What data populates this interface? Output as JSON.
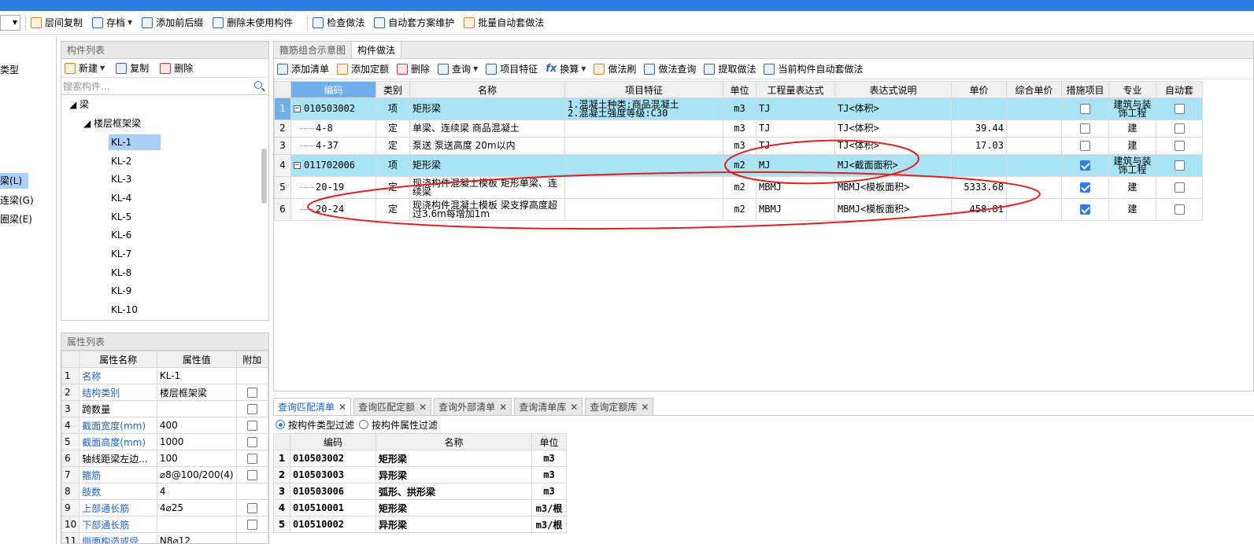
{
  "toolbar": {
    "items": [
      "层间复制",
      "存档",
      "添加前后缀",
      "删除未使用构件",
      "检查做法",
      "自动套方案维护",
      "批量自动套做法"
    ]
  },
  "left_edge": {
    "items": [
      "类型",
      "梁(L)",
      "连梁(G)",
      "圈梁(E)"
    ]
  },
  "component_list": {
    "title": "构件列表",
    "new_label": "新建",
    "copy_label": "复制",
    "delete_label": "删除",
    "search_placeholder": "搜索构件...",
    "root": "梁",
    "group": "楼层框架梁",
    "items": [
      "KL-1",
      "KL-2",
      "KL-3",
      "KL-4",
      "KL-5",
      "KL-6",
      "KL-7",
      "KL-8",
      "KL-9",
      "KL-10"
    ]
  },
  "property_list": {
    "title": "属性列表",
    "headers": [
      "属性名称",
      "属性值",
      "附加"
    ],
    "rows": [
      {
        "n": "1",
        "name": "名称",
        "value": "KL-1",
        "blue": true,
        "chk": false
      },
      {
        "n": "2",
        "name": "结构类别",
        "value": "楼层框架梁",
        "blue": true,
        "chk": true
      },
      {
        "n": "3",
        "name": "跨数量",
        "value": "",
        "blue": false,
        "chk": true
      },
      {
        "n": "4",
        "name": "截面宽度(mm)",
        "value": "400",
        "blue": true,
        "chk": true
      },
      {
        "n": "5",
        "name": "截面高度(mm)",
        "value": "1000",
        "blue": true,
        "chk": true
      },
      {
        "n": "6",
        "name": "轴线距梁左边...",
        "value": "100",
        "blue": false,
        "chk": true
      },
      {
        "n": "7",
        "name": "箍筋",
        "value": "⌀8@100/200(4)",
        "blue": true,
        "chk": true
      },
      {
        "n": "8",
        "name": "肢数",
        "value": "4",
        "blue": true,
        "chk": false
      },
      {
        "n": "9",
        "name": "上部通长筋",
        "value": "4⌀25",
        "blue": true,
        "chk": true
      },
      {
        "n": "10",
        "name": "下部通长筋",
        "value": "",
        "blue": true,
        "chk": true
      },
      {
        "n": "11",
        "name": "侧面构造或受...",
        "value": "N8⌀12",
        "blue": true,
        "chk": false
      }
    ]
  },
  "main": {
    "tabs": [
      "箍筋组合示意图",
      "构件做法"
    ],
    "tools": [
      "添加清单",
      "添加定额",
      "删除",
      "查询",
      "项目特征",
      "换算",
      "做法刷",
      "做法查询",
      "提取做法",
      "当前构件自动套做法"
    ],
    "headers": [
      "编码",
      "类别",
      "名称",
      "项目特征",
      "单位",
      "工程量表达式",
      "表达式说明",
      "单价",
      "综合单价",
      "措施项目",
      "专业",
      "自动套"
    ],
    "rows": [
      {
        "n": "1",
        "code": "010503002",
        "type": "项",
        "name": "矩形梁",
        "feature": "1.混凝土种类:商品混凝土\n2.混凝土强度等级:C30",
        "unit": "m3",
        "expr": "TJ",
        "desc": "TJ<体积>",
        "price": "",
        "cprice": "",
        "measure": false,
        "major": "建筑与装饰工程",
        "auto": false,
        "top": true
      },
      {
        "n": "2",
        "code": "4-8",
        "type": "定",
        "name": "单梁、连续梁 商品混凝土",
        "feature": "",
        "unit": "m3",
        "expr": "TJ",
        "desc": "TJ<体积>",
        "price": "39.44",
        "cprice": "",
        "measure": false,
        "major": "建",
        "auto": false,
        "top": false
      },
      {
        "n": "3",
        "code": "4-37",
        "type": "定",
        "name": "泵送 泵送高度 20m以内",
        "feature": "",
        "unit": "m3",
        "expr": "TJ",
        "desc": "TJ<体积>",
        "price": "17.03",
        "cprice": "",
        "measure": false,
        "major": "建",
        "auto": false,
        "top": false
      },
      {
        "n": "4",
        "code": "011702006",
        "type": "项",
        "name": "矩形梁",
        "feature": "",
        "unit": "m2",
        "expr": "MJ",
        "desc": "MJ<截面面积>",
        "price": "",
        "cprice": "",
        "measure": true,
        "major": "建筑与装饰工程",
        "auto": false,
        "top": true
      },
      {
        "n": "5",
        "code": "20-19",
        "type": "定",
        "name": "现浇构件混凝土模板 矩形单梁、连续梁",
        "feature": "",
        "unit": "m2",
        "expr": "MBMJ",
        "desc": "MBMJ<模板面积>",
        "price": "5333.68",
        "cprice": "",
        "measure": true,
        "major": "建",
        "auto": false,
        "top": false
      },
      {
        "n": "6",
        "code": "20-24",
        "type": "定",
        "name": "现浇构件混凝土模板 梁支撑高度超过3.6m每增加1m",
        "feature": "",
        "unit": "m2",
        "expr": "MBMJ",
        "desc": "MBMJ<模板面积>",
        "price": "458.81",
        "cprice": "",
        "measure": true,
        "major": "建",
        "auto": false,
        "top": false
      }
    ]
  },
  "query": {
    "tabs": [
      "查询匹配清单",
      "查询匹配定额",
      "查询外部清单",
      "查询清单库",
      "查询定额库"
    ],
    "radio1": "按构件类型过滤",
    "radio2": "按构件属性过滤",
    "headers": [
      "编码",
      "名称",
      "单位"
    ],
    "rows": [
      {
        "n": "1",
        "code": "010503002",
        "name": "矩形梁",
        "unit": "m3"
      },
      {
        "n": "2",
        "code": "010503003",
        "name": "异形梁",
        "unit": "m3"
      },
      {
        "n": "3",
        "code": "010503006",
        "name": "弧形、拱形梁",
        "unit": "m3"
      },
      {
        "n": "4",
        "code": "010510001",
        "name": "矩形梁",
        "unit": "m3/根"
      },
      {
        "n": "5",
        "code": "010510002",
        "name": "异形梁",
        "unit": "m3/根"
      }
    ]
  },
  "colors": {
    "title_bar": "#2b7de0",
    "selection": "#a9d1f7",
    "row_highlight": "#a8e4f4",
    "annotation": "#e02020"
  }
}
